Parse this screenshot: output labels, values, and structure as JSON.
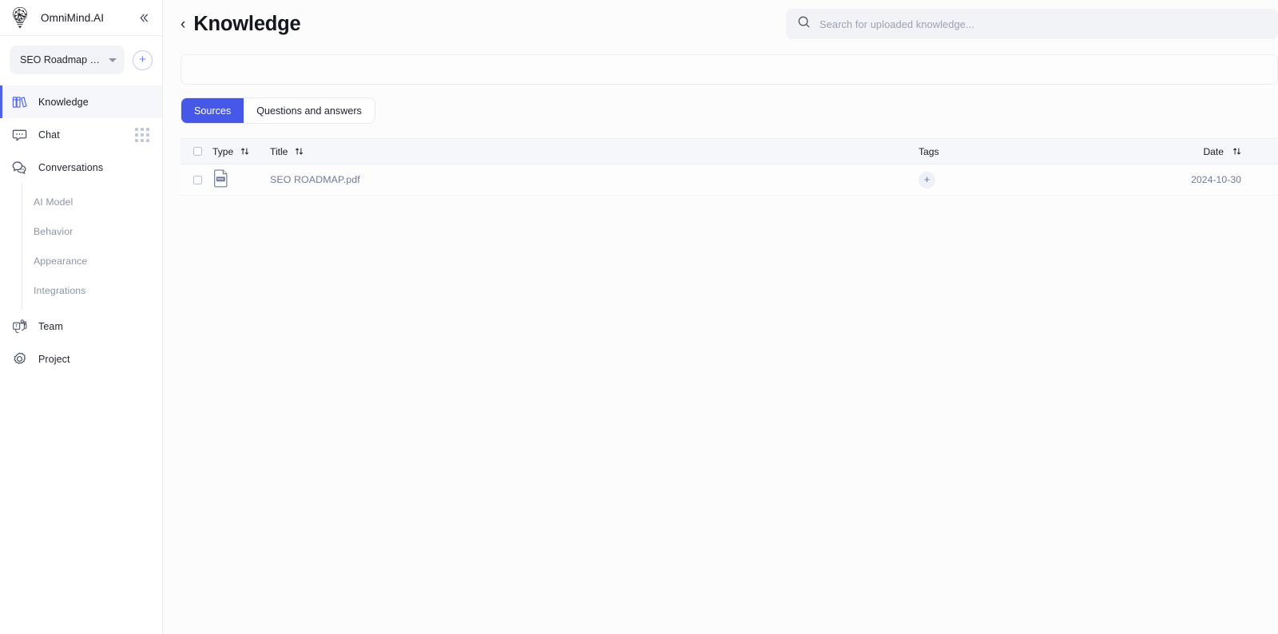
{
  "brand": {
    "name": "OmniMind.AI",
    "logo_icon": "lightbulb-network-icon",
    "collapse_icon": "double-chevron-left-icon"
  },
  "sidebar": {
    "project_selector": {
      "value": "SEO Roadmap Chat...",
      "caret_icon": "caret-down-icon"
    },
    "add_button": {
      "label": "+",
      "icon": "plus-circle-icon"
    },
    "apps_grid_icon": "apps-grid-icon",
    "items": [
      {
        "label": "Knowledge",
        "icon": "books-icon",
        "active": true
      },
      {
        "label": "Chat",
        "icon": "chat-bubble-icon",
        "active": false
      },
      {
        "label": "Conversations",
        "icon": "conversations-bubbles-icon",
        "active": false
      }
    ],
    "subitems": [
      {
        "label": "AI Model"
      },
      {
        "label": "Behavior"
      },
      {
        "label": "Appearance"
      },
      {
        "label": "Integrations"
      }
    ],
    "items_bottom": [
      {
        "label": "Team",
        "icon": "team-icon"
      },
      {
        "label": "Project",
        "icon": "gear-icon"
      }
    ]
  },
  "header": {
    "back_icon": "chevron-left-icon",
    "title": "Knowledge"
  },
  "search": {
    "placeholder": "Search for uploaded knowledge...",
    "icon": "search-icon"
  },
  "tabs": [
    {
      "label": "Sources",
      "active": true
    },
    {
      "label": "Questions and answers",
      "active": false
    }
  ],
  "table": {
    "columns": {
      "type": "Type",
      "title": "Title",
      "tags": "Tags",
      "date": "Date"
    },
    "sort_icon": "sort-updown-icon",
    "rows": [
      {
        "type_icon": "pdf-file-icon",
        "title": "SEO ROADMAP.pdf",
        "tag_add_label": "+",
        "date": "2024-10-30"
      }
    ]
  },
  "colors": {
    "accent": "#4558e8",
    "sidebar_active_bg": "#f6f7fa",
    "link": "#6f7c95",
    "search_bg": "#f1f3f7"
  }
}
